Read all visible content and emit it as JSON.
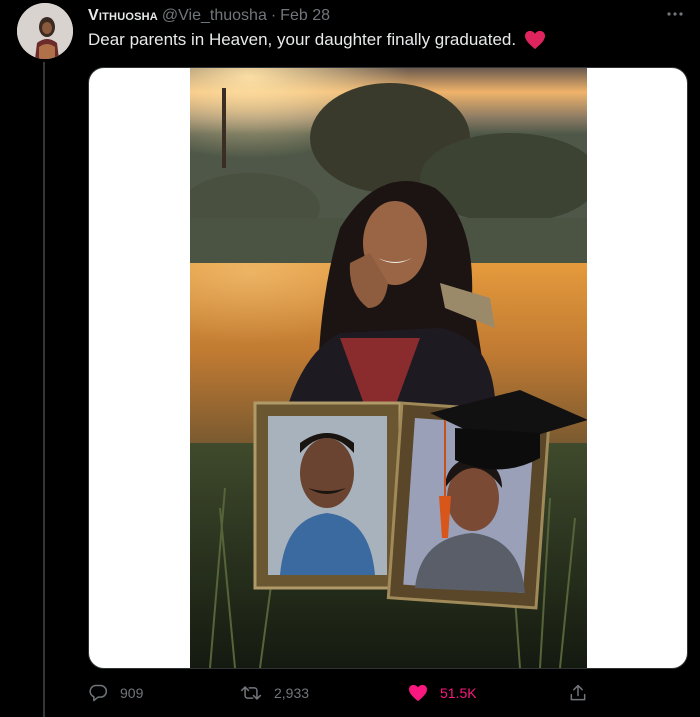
{
  "tweet": {
    "display_name": "Vithuosha",
    "handle": "@Vie_thuosha",
    "separator": "·",
    "date": "Feb 28",
    "text": "Dear parents in Heaven, your daughter finally graduated.",
    "emoji_icon": "red-heart-icon"
  },
  "actions": {
    "replies": "909",
    "retweets": "2,933",
    "likes": "51.5K",
    "like_color": "#f91880"
  },
  "colors": {
    "background": "#000000",
    "text": "#e7e9ea",
    "muted": "#71767b",
    "heart": "#f91880"
  }
}
